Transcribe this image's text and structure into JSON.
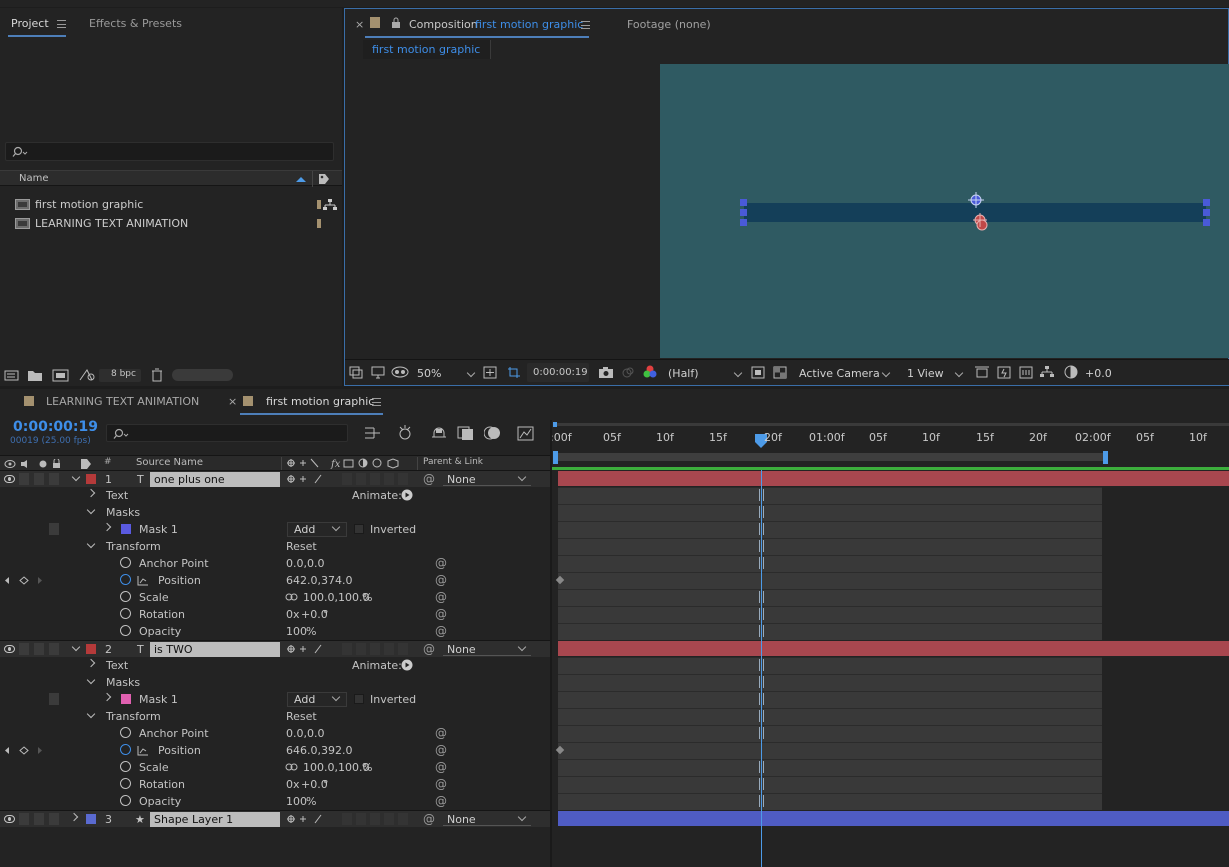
{
  "project_panel": {
    "tabs": [
      {
        "label": "Project"
      },
      {
        "label": "Effects & Presets"
      }
    ],
    "columns": {
      "name": "Name"
    },
    "items": [
      {
        "label": "first motion graphic"
      },
      {
        "label": "LEARNING TEXT ANIMATION"
      }
    ],
    "footer": {
      "bpc": "8 bpc"
    }
  },
  "comp_panel": {
    "close": "×",
    "tab_prefix": "Composition",
    "tab_name": "first motion graphic",
    "footage_tab": "Footage  (none)",
    "breadcrumb": "first motion graphic",
    "canvas_color": "#2f5a62",
    "bar": {
      "zoom": "50%",
      "timecode": "0:00:00:19",
      "resolution": "(Half)",
      "camera": "Active Camera",
      "views": "1 View",
      "exposure": "+0.0"
    }
  },
  "timeline": {
    "tabs": [
      {
        "label": "LEARNING TEXT ANIMATION"
      },
      {
        "label": "first motion graphic"
      }
    ],
    "close": "×",
    "timecode": "0:00:00:19",
    "frame_info": "00019 (25.00 fps)",
    "headers": {
      "source_name": "Source Name",
      "parent_link": "Parent & Link"
    },
    "ruler": [
      ":00f",
      "05f",
      "10f",
      "15f",
      "20f",
      "01:00f",
      "05f",
      "10f",
      "15f",
      "20f",
      "02:00f",
      "05f",
      "10f"
    ],
    "labels": {
      "text": "Text",
      "animate": "Animate:",
      "masks": "Masks",
      "transform": "Transform",
      "reset": "Reset",
      "anchor_point": "Anchor Point",
      "position": "Position",
      "scale": "Scale",
      "rotation": "Rotation",
      "opacity": "Opacity",
      "inverted": "Inverted",
      "mode": "Add",
      "parent": "None"
    },
    "layers": [
      {
        "index": "1",
        "type_icon": "T",
        "name": "one plus one",
        "color": "#b53a3a",
        "mask": {
          "name": "Mask 1",
          "color": "#5a5ae0"
        },
        "anchor_point": "0.0,0.0",
        "position": "642.0,374.0",
        "scale": "100.0,100.0",
        "scale_unit": "%",
        "rotation": "0",
        "rotation_x": "x",
        "rotation_deg": "+0.0",
        "rotation_unit": "°",
        "opacity": "100",
        "opacity_unit": "%"
      },
      {
        "index": "2",
        "type_icon": "T",
        "name": "is TWO",
        "color": "#b53a3a",
        "mask": {
          "name": "Mask 1",
          "color": "#e060b0"
        },
        "anchor_point": "0.0,0.0",
        "position": "646.0,392.0",
        "scale": "100.0,100.0",
        "scale_unit": "%",
        "rotation": "0",
        "rotation_x": "x",
        "rotation_deg": "+0.0",
        "rotation_unit": "°",
        "opacity": "100",
        "opacity_unit": "%"
      },
      {
        "index": "3",
        "type_icon": "★",
        "name": "Shape Layer 1",
        "color": "#5a6ad0"
      }
    ]
  }
}
